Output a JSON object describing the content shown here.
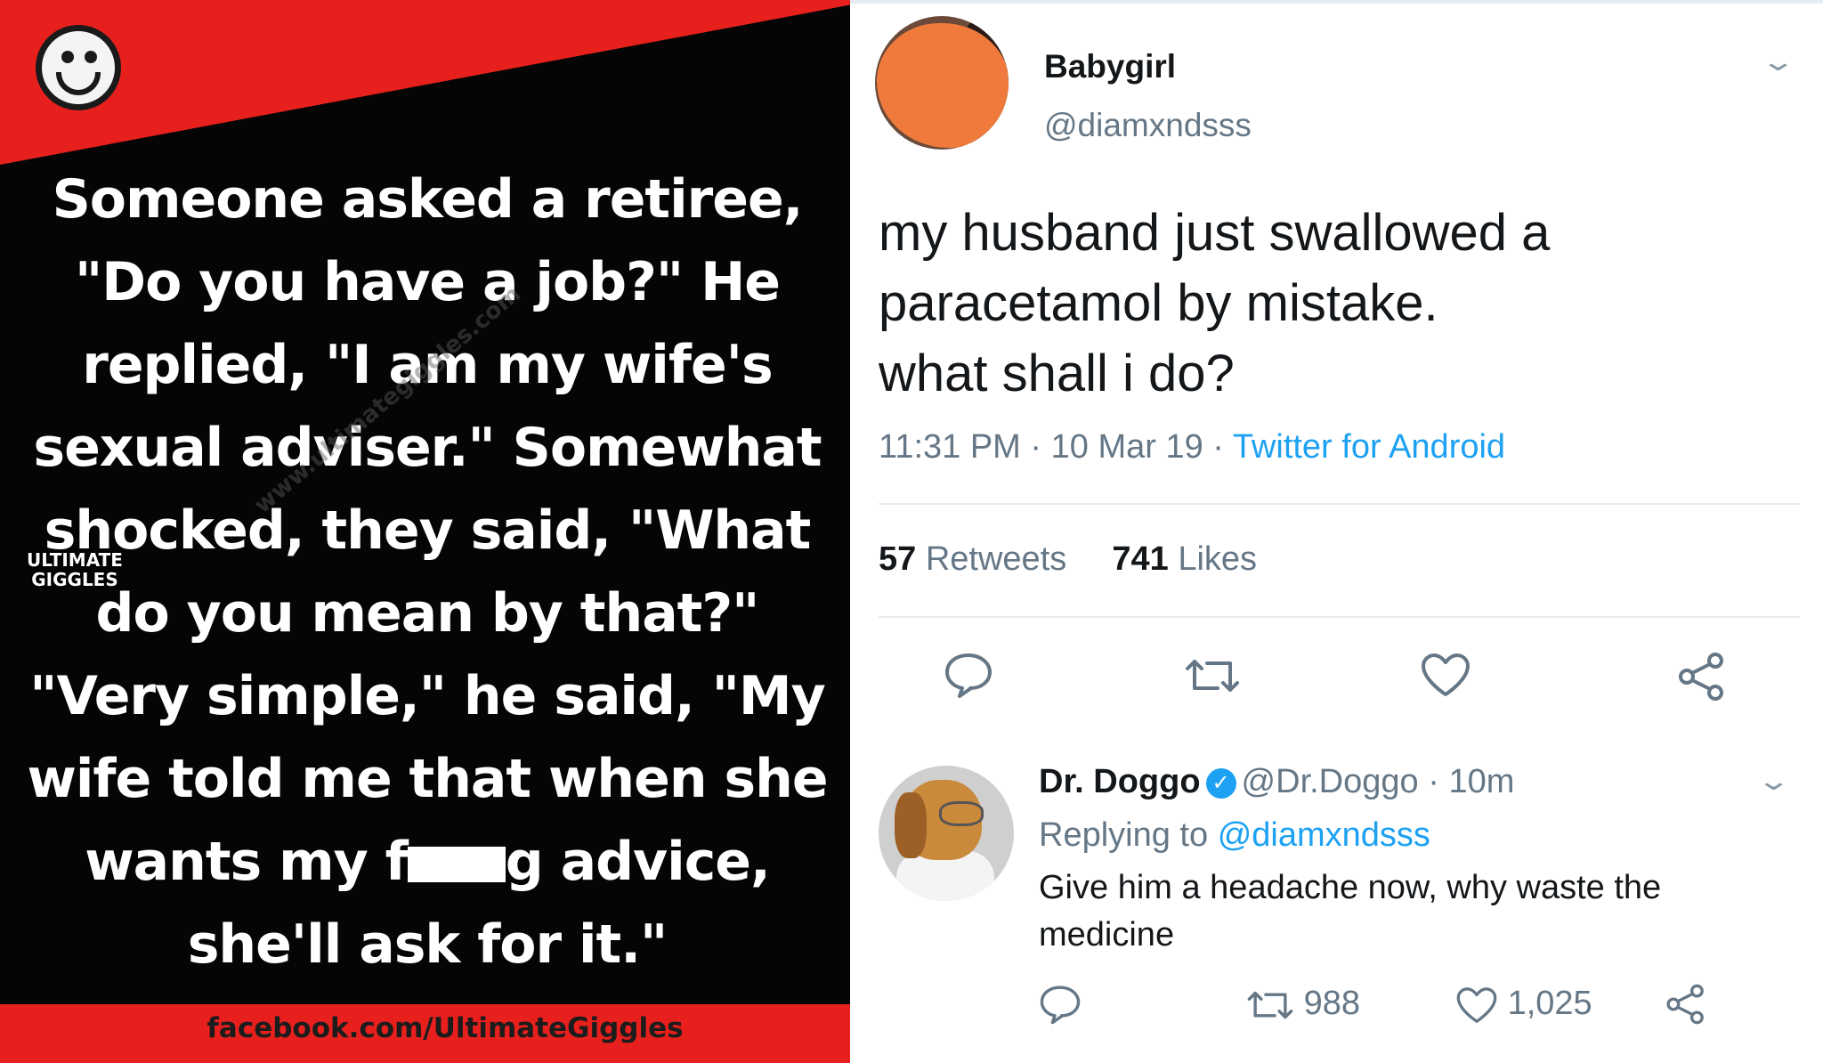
{
  "meme": {
    "lines": [
      "Someone asked a retiree,",
      "\"Do you have a job?\" He",
      "replied, \"I am my wife's",
      "sexual adviser.\" Somewhat",
      "shocked, they said, \"What",
      "do you mean by that?\"",
      "\"Very simple,\" he said, \"My",
      "wife told me that when she"
    ],
    "line9_before": "wants my f",
    "line9_after": "g advice,",
    "line10": "she'll ask for it.\"",
    "brand_top": "ULTIMATE",
    "brand_bottom": "GIGGLES",
    "watermark": "www.ultimategiggles.com",
    "footer": "facebook.com/UltimateGiggles"
  },
  "tweet": {
    "name": "Babygirl",
    "handle": "@diamxndsss",
    "text_lines": [
      "my husband just swallowed a",
      "paracetamol by mistake.",
      "what shall i do?"
    ],
    "time": "11:31 PM",
    "date": "10 Mar 19",
    "source": "Twitter for Android",
    "sep": " · ",
    "retweets_count": "57",
    "retweets_label": "Retweets",
    "likes_count": "741",
    "likes_label": "Likes"
  },
  "reply": {
    "name": "Dr. Doggo",
    "handle": "@Dr.Doggo",
    "time_ago": "10m",
    "replying_label": "Replying to",
    "replying_handle": "@diamxndsss",
    "text_line1": "Give him a headache now, why waste the",
    "text_line2": "medicine",
    "retweet_count": "988",
    "like_count": "1,025"
  },
  "colors": {
    "twitter_blue": "#1da1f2",
    "meme_red": "#e8201d",
    "muted": "#657786"
  }
}
